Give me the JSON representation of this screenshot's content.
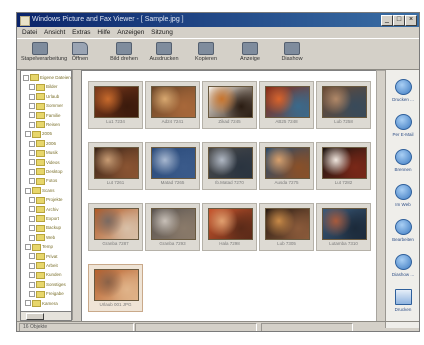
{
  "window": {
    "title": "Windows Picture and Fax Viewer - [ Sample.jpg ]",
    "controls": [
      "_",
      "□",
      "×"
    ]
  },
  "menu": [
    "Datei",
    "Ansicht",
    "Extras",
    "Hilfe",
    "Anzeigen",
    "Sitzung"
  ],
  "toolbar": [
    {
      "label": "Stapelverarbeitung",
      "icon": "batch-icon"
    },
    {
      "label": "Öffnen",
      "icon": "open-icon"
    },
    {
      "label": "Bild drehen",
      "icon": "rotate-icon"
    },
    {
      "label": "Ausdrucken",
      "icon": "print-icon"
    },
    {
      "label": "Kopieren",
      "icon": "copy-icon"
    },
    {
      "label": "Anzeige",
      "icon": "view-icon"
    },
    {
      "label": "Diashow",
      "icon": "slideshow-icon"
    }
  ],
  "tree": {
    "nodes": [
      "Eigene Dateien",
      "Bilder",
      "Urlaub",
      "Sommer",
      "Familie",
      "Reisen",
      "2005",
      "2006",
      "Musik",
      "Videos",
      "Desktop",
      "Fotos",
      "Scans",
      "Projekte",
      "Archiv",
      "Export",
      "Backup",
      "Web",
      "Temp",
      "Privat",
      "Arbeit",
      "Kunden",
      "Sonstiges",
      "Freigabe",
      "Kamera"
    ]
  },
  "gallery": {
    "selected_index": 15,
    "items": [
      {
        "caption": "Lu1 7234",
        "colors": [
          "#7c3a1c",
          "#c76a2c",
          "#3b1a0c"
        ]
      },
      {
        "caption": "Ad24 7241",
        "colors": [
          "#6a4528",
          "#d8a870",
          "#a8683a"
        ]
      },
      {
        "caption": "Zikad 7245",
        "colors": [
          "#f4ece2",
          "#c8742c",
          "#2a1c12"
        ]
      },
      {
        "caption": "AB25 7248",
        "colors": [
          "#8a2a14",
          "#d8642c",
          "#3a6a8c"
        ]
      },
      {
        "caption": "Lub 7258",
        "colors": [
          "#6a4a34",
          "#b08868",
          "#384a5a"
        ]
      },
      {
        "caption": "Lut 7261",
        "colors": [
          "#3a2418",
          "#c89c74",
          "#8a5432"
        ]
      },
      {
        "caption": "Matad 7265",
        "colors": [
          "#2a4a7a",
          "#a8b8d0",
          "#3a5a8a"
        ]
      },
      {
        "caption": "Ib.Matad 7270",
        "colors": [
          "#4a4a4a",
          "#b0b8c4",
          "#2a3440"
        ]
      },
      {
        "caption": "Ausda 7275",
        "colors": [
          "#2a4a6a",
          "#d8a06c",
          "#8a5028"
        ]
      },
      {
        "caption": "Lut 7282",
        "colors": [
          "#1c1410",
          "#f0e6de",
          "#7a2818"
        ]
      },
      {
        "caption": "Granba 7287",
        "colors": [
          "#b25a26",
          "#7a6a62",
          "#d8c0a8"
        ]
      },
      {
        "caption": "Granba 7293",
        "colors": [
          "#5a5450",
          "#c8c0b8",
          "#8a7a6a"
        ]
      },
      {
        "caption": "Hala 7298",
        "colors": [
          "#c8542c",
          "#e0a070",
          "#5a2a18"
        ]
      },
      {
        "caption": "Lub 7305",
        "colors": [
          "#2a1c14",
          "#c88a48",
          "#8a5a3a"
        ]
      },
      {
        "caption": "Lutamba 7310",
        "colors": [
          "#3a5a7a",
          "#a85a3c",
          "#1c2a3a"
        ]
      },
      {
        "caption": "Urlaub 001 JPG",
        "colors": [
          "#b8602c",
          "#8a6248",
          "#e0b48a"
        ]
      }
    ]
  },
  "actions": [
    {
      "label": "Drucken ...",
      "icon": "print-icon"
    },
    {
      "label": "Per E-Mail",
      "icon": "email-icon"
    },
    {
      "label": "Brennen",
      "icon": "burn-icon"
    },
    {
      "label": "Im Web",
      "icon": "web-icon"
    },
    {
      "label": "Bearbeiten",
      "icon": "edit-icon"
    },
    {
      "label": "Diashow ...",
      "icon": "slideshow-icon"
    },
    {
      "label": "Drucken",
      "icon": "print-icon"
    }
  ],
  "statusbar": {
    "text": "16 Objekte"
  }
}
